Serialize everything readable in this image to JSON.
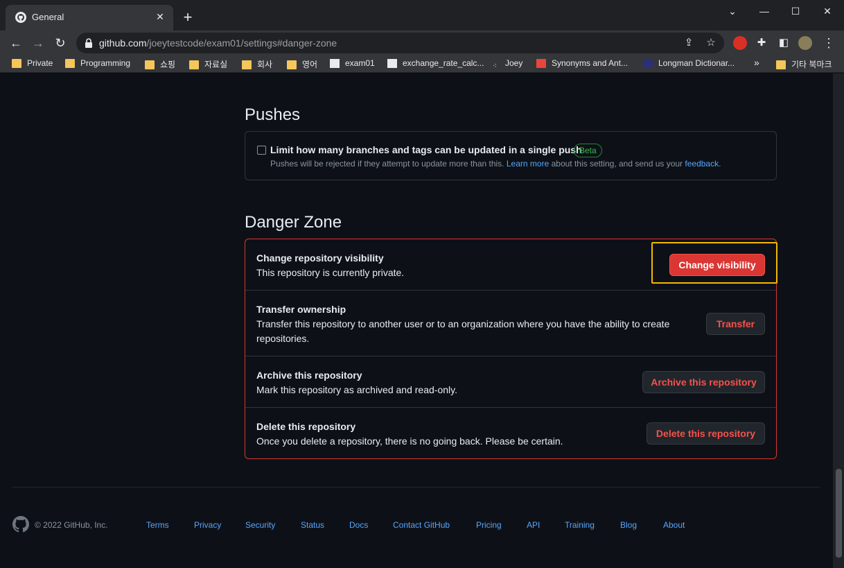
{
  "browser": {
    "tab_title": "General",
    "url_domain": "github.com",
    "url_path": "/joeytestcode/exam01/settings#danger-zone",
    "window_controls": {
      "minimize": "⌄",
      "min": "—",
      "max": "☐",
      "close": "✕"
    },
    "bookmarks": [
      {
        "label": "Private",
        "icon": "folder-icon"
      },
      {
        "label": "Programming",
        "icon": "folder-icon"
      },
      {
        "label": "쇼핑",
        "icon": "folder-icon"
      },
      {
        "label": "자료실",
        "icon": "folder-icon"
      },
      {
        "label": "회사",
        "icon": "folder-icon"
      },
      {
        "label": "영어",
        "icon": "folder-icon"
      },
      {
        "label": "exam01",
        "icon": "flutter-icon"
      },
      {
        "label": "exchange_rate_calc...",
        "icon": "flutter-icon"
      },
      {
        "label": "Joey",
        "icon": "dots-icon"
      },
      {
        "label": "Synonyms and Ant...",
        "icon": "thesaurus-icon"
      },
      {
        "label": "Longman Dictionar...",
        "icon": "longman-icon"
      }
    ],
    "bookmarks_overflow": "»",
    "other_bookmarks": "기타 북마크"
  },
  "pushes": {
    "heading": "Pushes",
    "label": "Limit how many branches and tags can be updated in a single push",
    "badge": "Beta",
    "note_prefix": "Pushes will be rejected if they attempt to update more than this.",
    "learn_more": "Learn more",
    "note_middle": "about this setting, and send us your",
    "feedback": "feedback",
    "note_suffix": "."
  },
  "danger_zone": {
    "heading": "Danger Zone",
    "rows": [
      {
        "title": "Change repository visibility",
        "desc": "This repository is currently private.",
        "button": "Change visibility"
      },
      {
        "title": "Transfer ownership",
        "desc": "Transfer this repository to another user or to an organization where you have the ability to create repositories.",
        "button": "Transfer"
      },
      {
        "title": "Archive this repository",
        "desc": "Mark this repository as archived and read-only.",
        "button": "Archive this repository"
      },
      {
        "title": "Delete this repository",
        "desc": "Once you delete a repository, there is no going back. Please be certain.",
        "button": "Delete this repository"
      }
    ]
  },
  "footer": {
    "copyright": "© 2022 GitHub, Inc.",
    "links": [
      "Terms",
      "Privacy",
      "Security",
      "Status",
      "Docs",
      "Contact GitHub",
      "Pricing",
      "API",
      "Training",
      "Blog",
      "About"
    ]
  },
  "colors": {
    "page_bg": "#0d1117",
    "danger": "#da3633",
    "link": "#58a6ff",
    "highlight": "#f5b800"
  }
}
